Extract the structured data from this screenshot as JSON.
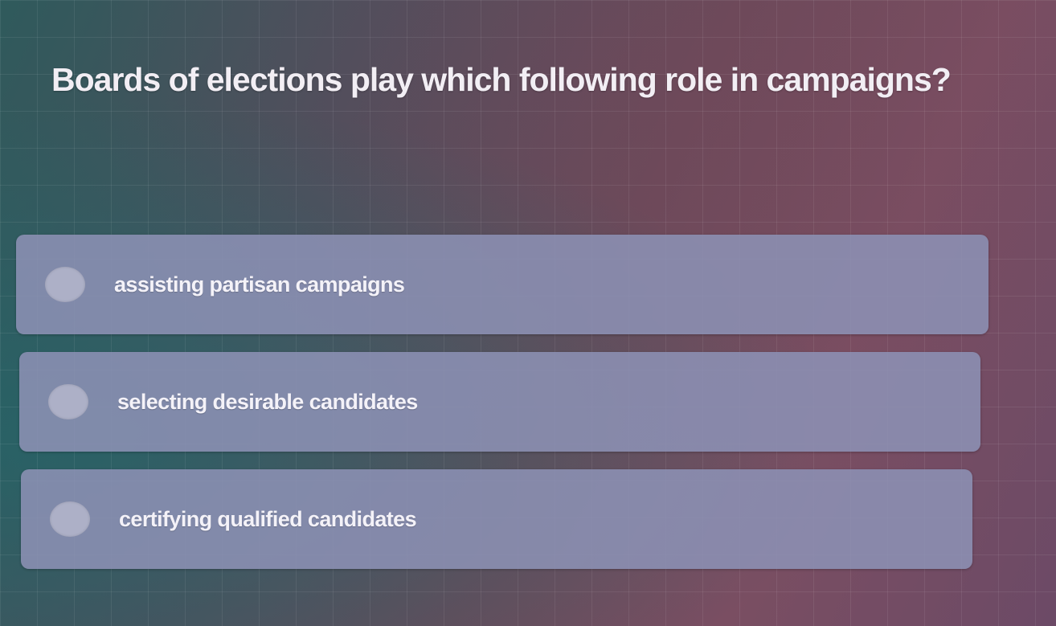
{
  "question": {
    "text": "Boards of elections play which following role in campaigns?"
  },
  "options": [
    {
      "label": "assisting partisan campaigns",
      "selected": false
    },
    {
      "label": "selecting desirable candidates",
      "selected": false
    },
    {
      "label": "certifying qualified candidates",
      "selected": false
    }
  ]
}
